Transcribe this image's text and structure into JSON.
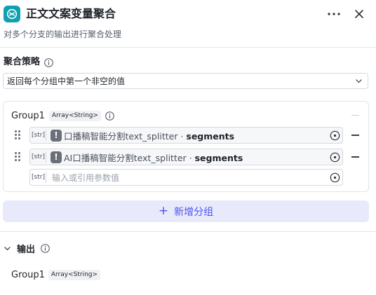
{
  "header": {
    "title": "正文文案变量聚合",
    "subtitle": "对多个分支的输出进行聚合处理",
    "icon": "aggregate-icon",
    "accent": "#10a1b0"
  },
  "strategy": {
    "label": "聚合策略",
    "selected": "返回每个分组中第一个非空的值"
  },
  "group": {
    "name": "Group1",
    "type": "Array<String>",
    "items": [
      {
        "tag": "[str]",
        "ref_node": "口播稿智能分割text_splitter",
        "sep": " · ",
        "ref_field": "segments"
      },
      {
        "tag": "[str]",
        "ref_node": "AI口播稿智能分割text_splitter",
        "sep": " · ",
        "ref_field": "segments"
      }
    ],
    "empty_item": {
      "tag": "[str]",
      "placeholder": "输入或引用参数值"
    }
  },
  "add_group": {
    "plus": "+",
    "label": "新增分组",
    "color": "#4d53e8"
  },
  "output": {
    "title": "输出",
    "group_name": "Group1",
    "group_type": "Array<String>"
  }
}
